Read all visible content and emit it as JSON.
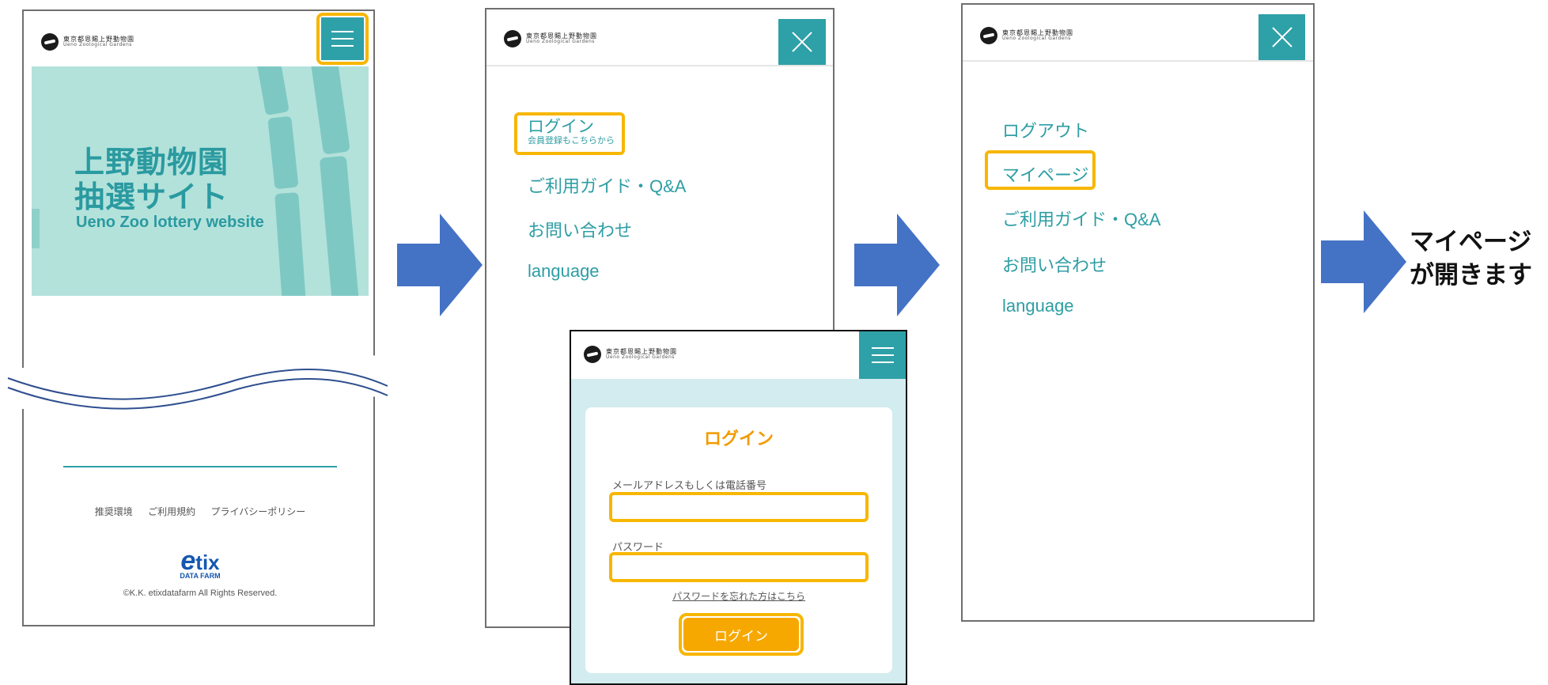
{
  "logo": {
    "name_jp": "東京都恩賜上野動物園",
    "name_en": "Ueno Zoological Gardens"
  },
  "colors": {
    "accent_teal": "#2ea0a8",
    "highlight_orange": "#f7b600",
    "arrow_blue": "#4472c4",
    "login_title": "#f39a00"
  },
  "step1": {
    "banner_title_line1": "上野動物園",
    "banner_title_line2": "抽選サイト",
    "banner_subtitle": "Ueno Zoo lottery website",
    "footer_links": [
      "推奨環境",
      "ご利用規約",
      "プライバシーポリシー"
    ],
    "etix_logo": "tix",
    "etix_sub": "DATA FARM",
    "copyright": "©K.K. etixdatafarm All Rights Reserved.",
    "menu_icon": "hamburger-icon"
  },
  "step2": {
    "menu": {
      "login": "ログイン",
      "login_sub": "会員登録もこちらから",
      "guide": "ご利用ガイド・Q&A",
      "contact": "お問い合わせ",
      "language": "language"
    },
    "close_icon": "close-icon"
  },
  "login_form": {
    "title": "ログイン",
    "email_label": "メールアドレスもしくは電話番号",
    "password_label": "パスワード",
    "forgot_link": "パスワードを忘れた方はこちら",
    "submit": "ログイン"
  },
  "step3": {
    "menu": {
      "logout": "ログアウト",
      "mypage": "マイページ",
      "guide": "ご利用ガイド・Q&A",
      "contact": "お問い合わせ",
      "language": "language"
    }
  },
  "result": {
    "line1": "マイページ",
    "line2": "が開きます"
  }
}
